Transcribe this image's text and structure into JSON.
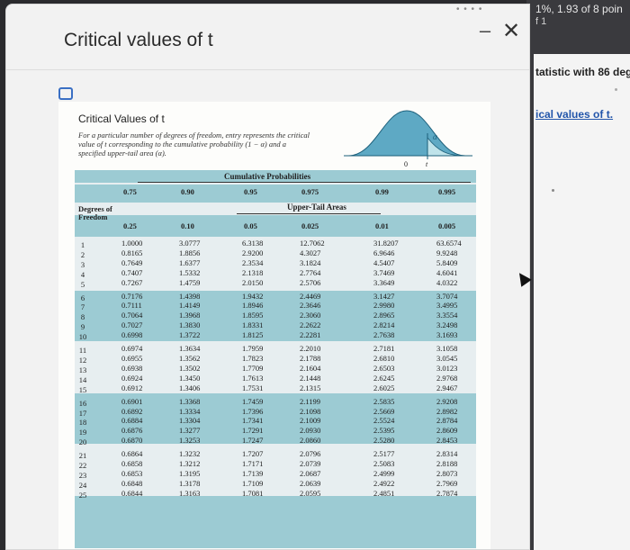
{
  "background": {
    "top_text_1": "1%, 1.93 of 8 poin",
    "top_text_2": "f 1",
    "side_text_1": "tatistic with 86 deg",
    "side_link": "ical values of t."
  },
  "window": {
    "title": "Critical values of t",
    "minimize_label": "–",
    "close_label": "✕"
  },
  "card": {
    "heading": "Critical Values of t",
    "description": "For a particular number of degrees of freedom, entry represents the critical value of t corresponding to the cumulative probability (1 − α) and a specified upper-tail area (α).",
    "bell_labels": {
      "zero": "0",
      "t": "t"
    }
  },
  "table": {
    "cumulative_label": "Cumulative Probabilities",
    "upper_tail_label": "Upper-Tail Areas",
    "df_label_line1": "Degrees of",
    "df_label_line2": "Freedom",
    "cumulative": [
      "0.75",
      "0.90",
      "0.95",
      "0.975",
      "0.99",
      "0.995"
    ],
    "upper_tail": [
      "0.25",
      "0.10",
      "0.05",
      "0.025",
      "0.01",
      "0.005"
    ],
    "df": [
      "1",
      "2",
      "3",
      "4",
      "5",
      "6",
      "7",
      "8",
      "9",
      "10",
      "11",
      "12",
      "13",
      "14",
      "15",
      "16",
      "17",
      "18",
      "19",
      "20",
      "21",
      "22",
      "23",
      "24",
      "25"
    ],
    "columns": [
      [
        "1.0000",
        "0.8165",
        "0.7649",
        "0.7407",
        "0.7267",
        "0.7176",
        "0.7111",
        "0.7064",
        "0.7027",
        "0.6998",
        "0.6974",
        "0.6955",
        "0.6938",
        "0.6924",
        "0.6912",
        "0.6901",
        "0.6892",
        "0.6884",
        "0.6876",
        "0.6870",
        "0.6864",
        "0.6858",
        "0.6853",
        "0.6848",
        "0.6844"
      ],
      [
        "3.0777",
        "1.8856",
        "1.6377",
        "1.5332",
        "1.4759",
        "1.4398",
        "1.4149",
        "1.3968",
        "1.3830",
        "1.3722",
        "1.3634",
        "1.3562",
        "1.3502",
        "1.3450",
        "1.3406",
        "1.3368",
        "1.3334",
        "1.3304",
        "1.3277",
        "1.3253",
        "1.3232",
        "1.3212",
        "1.3195",
        "1.3178",
        "1.3163"
      ],
      [
        "6.3138",
        "2.9200",
        "2.3534",
        "2.1318",
        "2.0150",
        "1.9432",
        "1.8946",
        "1.8595",
        "1.8331",
        "1.8125",
        "1.7959",
        "1.7823",
        "1.7709",
        "1.7613",
        "1.7531",
        "1.7459",
        "1.7396",
        "1.7341",
        "1.7291",
        "1.7247",
        "1.7207",
        "1.7171",
        "1.7139",
        "1.7109",
        "1.7081"
      ],
      [
        "12.7062",
        "4.3027",
        "3.1824",
        "2.7764",
        "2.5706",
        "2.4469",
        "2.3646",
        "2.3060",
        "2.2622",
        "2.2281",
        "2.2010",
        "2.1788",
        "2.1604",
        "2.1448",
        "2.1315",
        "2.1199",
        "2.1098",
        "2.1009",
        "2.0930",
        "2.0860",
        "2.0796",
        "2.0739",
        "2.0687",
        "2.0639",
        "2.0595"
      ],
      [
        "31.8207",
        "6.9646",
        "4.5407",
        "3.7469",
        "3.3649",
        "3.1427",
        "2.9980",
        "2.8965",
        "2.8214",
        "2.7638",
        "2.7181",
        "2.6810",
        "2.6503",
        "2.6245",
        "2.6025",
        "2.5835",
        "2.5669",
        "2.5524",
        "2.5395",
        "2.5280",
        "2.5177",
        "2.5083",
        "2.4999",
        "2.4922",
        "2.4851"
      ],
      [
        "63.6574",
        "9.9248",
        "5.8409",
        "4.6041",
        "4.0322",
        "3.7074",
        "3.4995",
        "3.3554",
        "3.2498",
        "3.1693",
        "3.1058",
        "3.0545",
        "3.0123",
        "2.9768",
        "2.9467",
        "2.9208",
        "2.8982",
        "2.8784",
        "2.8609",
        "2.8453",
        "2.8314",
        "2.8188",
        "2.8073",
        "2.7969",
        "2.7874"
      ]
    ]
  },
  "colors": {
    "accent": "#3a6fc4",
    "table_band": "#9ccbd3",
    "bell_fill": "#5ea9c4"
  }
}
